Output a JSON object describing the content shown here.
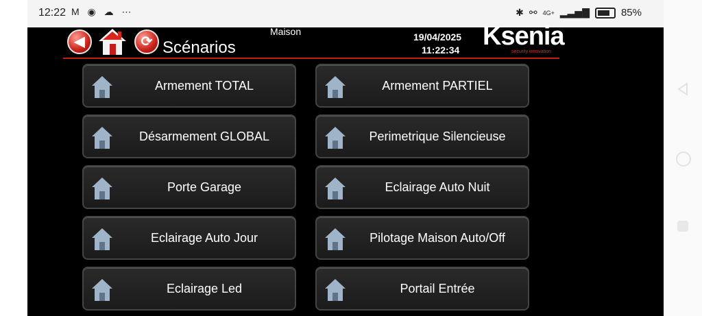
{
  "status": {
    "time": "12:22",
    "left_icons": "M ◉ ☁ ⋯",
    "signal": "4G+",
    "battery": "85%"
  },
  "header": {
    "title": "Scénarios",
    "location": "Maison",
    "date": "19/04/2025",
    "time": "11:22:34",
    "logo": "Ksenia",
    "logo_tagline": "security innovation"
  },
  "scenarios": [
    {
      "label": "Armement TOTAL"
    },
    {
      "label": "Armement PARTIEL"
    },
    {
      "label": "Désarmement GLOBAL"
    },
    {
      "label": "Perimetrique Silencieuse"
    },
    {
      "label": "Porte Garage"
    },
    {
      "label": "Eclairage Auto Nuit"
    },
    {
      "label": "Eclairage Auto Jour"
    },
    {
      "label": "Pilotage Maison Auto/Off"
    },
    {
      "label": "Eclairage Led"
    },
    {
      "label": "Portail Entrée"
    }
  ],
  "colors": {
    "accent_red": "#c41d1d",
    "background": "#000000",
    "button": "#222222"
  }
}
